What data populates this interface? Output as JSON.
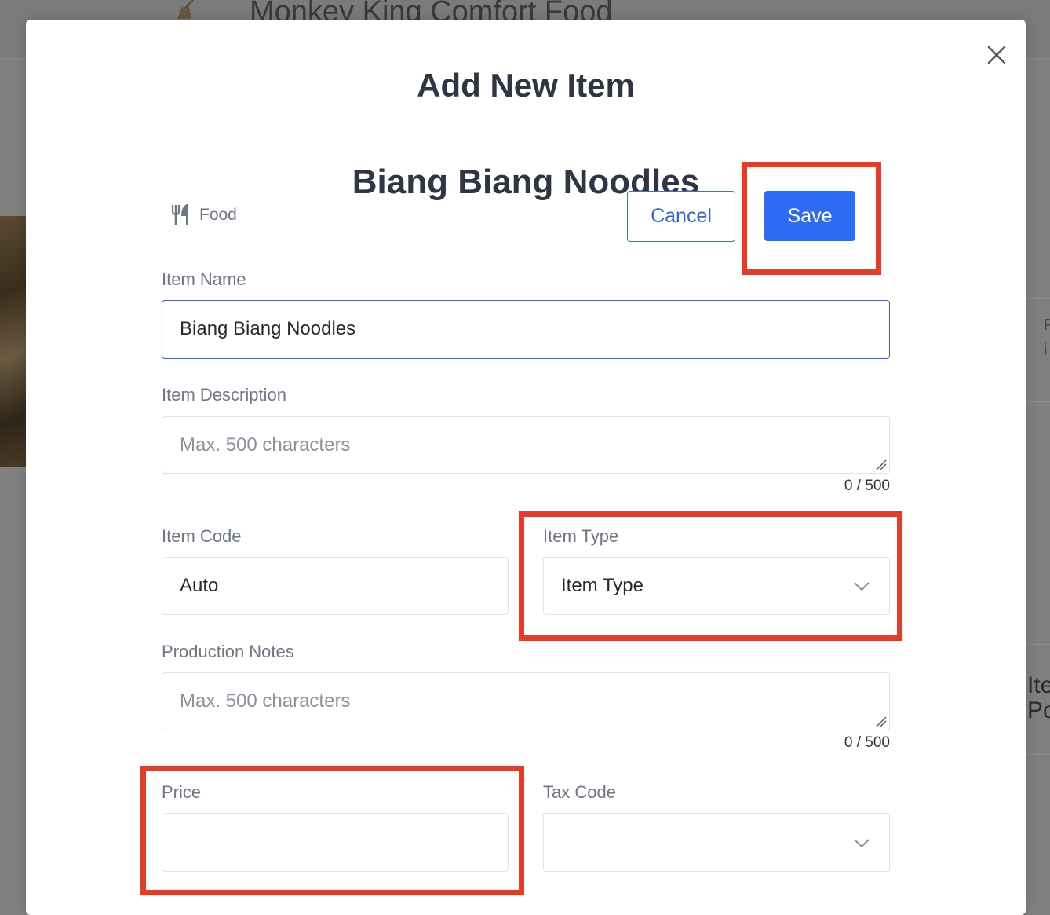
{
  "background": {
    "restaurant_name": "Monkey King Comfort Food",
    "side_text_1": "F",
    "side_text_2": "i",
    "side_big_1": "Ite",
    "side_big_2": "Po"
  },
  "modal": {
    "title": "Add New Item",
    "close_icon": "close-icon"
  },
  "item": {
    "heading": "Biang Biang Noodles",
    "category_icon": "fork-knife-icon",
    "category_label": "Food"
  },
  "actions": {
    "cancel_label": "Cancel",
    "save_label": "Save"
  },
  "form": {
    "item_name": {
      "label": "Item Name",
      "value": "Biang Biang Noodles"
    },
    "item_description": {
      "label": "Item Description",
      "placeholder": "Max. 500 characters",
      "counter": "0 / 500"
    },
    "item_code": {
      "label": "Item Code",
      "value": "Auto"
    },
    "item_type": {
      "label": "Item Type",
      "value": "Item Type"
    },
    "production_notes": {
      "label": "Production Notes",
      "placeholder": "Max. 500 characters",
      "counter": "0 / 500"
    },
    "price": {
      "label": "Price",
      "value": ""
    },
    "tax_code": {
      "label": "Tax Code",
      "value": ""
    }
  },
  "colors": {
    "accent": "#2f6bf2",
    "highlight": "#e63b27",
    "heading": "#2f3542",
    "label": "#6e7686"
  }
}
